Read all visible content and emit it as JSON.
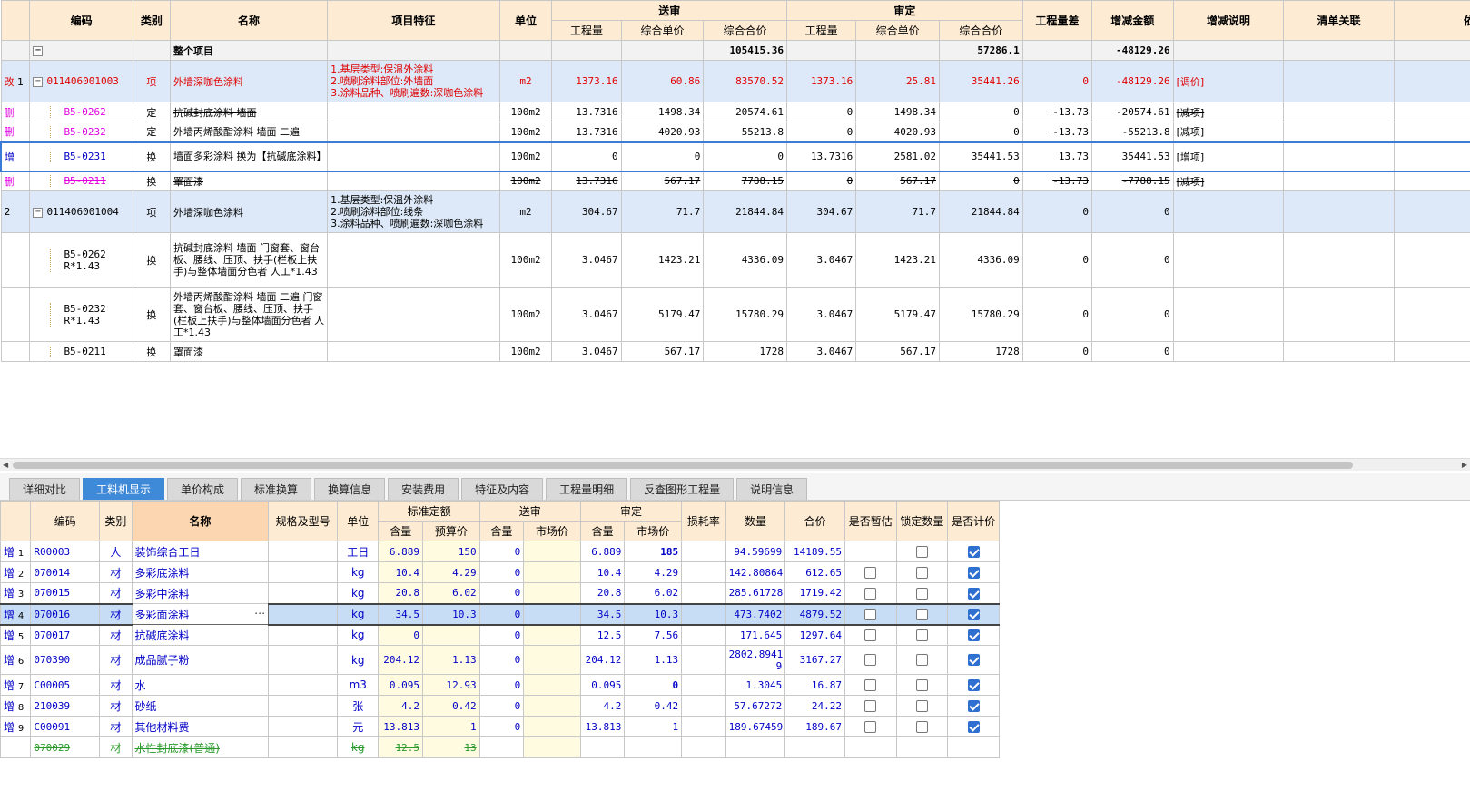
{
  "top": {
    "headers": {
      "code": "编码",
      "type": "类别",
      "name": "名称",
      "feature": "项目特征",
      "unit": "单位",
      "send": "送审",
      "audit": "审定",
      "qty": "工程量",
      "unit_price": "综合单价",
      "total": "综合合价",
      "qty_diff": "工程量差",
      "amt_change": "增减金额",
      "change_note": "增减说明",
      "list_link": "清单关联",
      "basis": "依据"
    },
    "summary": {
      "name": "整个项目",
      "send_total": "105415.36",
      "audit_total": "57286.1",
      "change": "-48129.26"
    },
    "rows": [
      {
        "flag": "改",
        "idx": "1",
        "code": "011406001003",
        "type": "项",
        "name": "外墙深咖色涂料",
        "feature": "1.基层类型:保温外涂料\n2.喷刷涂料部位:外墙面\n3.涂料品种、喷刷遍数:深咖色涂料",
        "unit": "m2",
        "s_qty": "1373.16",
        "s_price": "60.86",
        "s_total": "83570.52",
        "a_qty": "1373.16",
        "a_price": "25.81",
        "a_total": "35441.26",
        "diff": "0",
        "chg": "-48129.26",
        "note": "[调价]"
      },
      {
        "flag": "删",
        "code": "B5-0262",
        "type": "定",
        "name": "抗碱封底涂料 墙面",
        "unit": "100m2",
        "s_qty": "13.7316",
        "s_price": "1498.34",
        "s_total": "20574.61",
        "a_qty": "0",
        "a_price": "1498.34",
        "a_total": "0",
        "diff": "-13.73",
        "chg": "-20574.61",
        "note": "[减项]"
      },
      {
        "flag": "删",
        "code": "B5-0232",
        "type": "定",
        "name": "外墙丙烯酸酯涂料 墙面 二遍",
        "unit": "100m2",
        "s_qty": "13.7316",
        "s_price": "4020.93",
        "s_total": "55213.8",
        "a_qty": "0",
        "a_price": "4020.93",
        "a_total": "0",
        "diff": "-13.73",
        "chg": "-55213.8",
        "note": "[减项]"
      },
      {
        "flag": "增",
        "code": "B5-0231",
        "type": "换",
        "name": "墙面多彩涂料  换为【抗碱底涂料】",
        "unit": "100m2",
        "s_qty": "0",
        "s_price": "0",
        "s_total": "0",
        "a_qty": "13.7316",
        "a_price": "2581.02",
        "a_total": "35441.53",
        "diff": "13.73",
        "chg": "35441.53",
        "note": "[增项]"
      },
      {
        "flag": "删",
        "code": "B5-0211",
        "type": "换",
        "name": "罩面漆",
        "unit": "100m2",
        "s_qty": "13.7316",
        "s_price": "567.17",
        "s_total": "7788.15",
        "a_qty": "0",
        "a_price": "567.17",
        "a_total": "0",
        "diff": "-13.73",
        "chg": "-7788.15",
        "note": "[减项]"
      },
      {
        "idx": "2",
        "code": "011406001004",
        "type": "项",
        "name": "外墙深咖色涂料",
        "feature": "1.基层类型:保温外涂料\n2.喷刷涂料部位:线条\n3.涂料品种、喷刷遍数:深咖色涂料",
        "unit": "m2",
        "s_qty": "304.67",
        "s_price": "71.7",
        "s_total": "21844.84",
        "a_qty": "304.67",
        "a_price": "71.7",
        "a_total": "21844.84",
        "diff": "0",
        "chg": "0"
      },
      {
        "code": "B5-0262\nR*1.43",
        "type": "换",
        "name": "抗碱封底涂料 墙面  门窗套、窗台板、腰线、压顶、扶手(栏板上扶手)与整体墙面分色者 人工*1.43",
        "unit": "100m2",
        "s_qty": "3.0467",
        "s_price": "1423.21",
        "s_total": "4336.09",
        "a_qty": "3.0467",
        "a_price": "1423.21",
        "a_total": "4336.09",
        "diff": "0",
        "chg": "0"
      },
      {
        "code": "B5-0232\nR*1.43",
        "type": "换",
        "name": "外墙丙烯酸酯涂料 墙面 二遍 门窗套、窗台板、腰线、压顶、扶手(栏板上扶手)与整体墙面分色者 人工*1.43",
        "unit": "100m2",
        "s_qty": "3.0467",
        "s_price": "5179.47",
        "s_total": "15780.29",
        "a_qty": "3.0467",
        "a_price": "5179.47",
        "a_total": "15780.29",
        "diff": "0",
        "chg": "0"
      },
      {
        "code": "B5-0211",
        "type": "换",
        "name": "罩面漆",
        "unit": "100m2",
        "s_qty": "3.0467",
        "s_price": "567.17",
        "s_total": "1728",
        "a_qty": "3.0467",
        "a_price": "567.17",
        "a_total": "1728",
        "diff": "0",
        "chg": "0"
      }
    ]
  },
  "tabs": [
    "详细对比",
    "工料机显示",
    "单价构成",
    "标准换算",
    "换算信息",
    "安装费用",
    "特征及内容",
    "工程量明细",
    "反查图形工程量",
    "说明信息"
  ],
  "bottom": {
    "headers": {
      "code": "编码",
      "type": "类别",
      "name": "名称",
      "spec": "规格及型号",
      "unit": "单位",
      "std": "标准定额",
      "send": "送审",
      "audit": "审定",
      "content": "含量",
      "budget": "预算价",
      "market": "市场价",
      "loss": "损耗率",
      "qty": "数量",
      "total": "合价",
      "est": "是否暂估",
      "lock": "锁定数量",
      "price": "是否计价"
    },
    "rows": [
      {
        "flag": "增",
        "idx": "1",
        "code": "R00003",
        "type": "人",
        "name": "装饰综合工日",
        "unit": "工日",
        "std_c": "6.889",
        "std_b": "150",
        "s_c": "0",
        "s_m": "",
        "a_c": "6.889",
        "a_m": "185",
        "qty": "94.59699",
        "total": "14189.55",
        "est": null,
        "lock": false,
        "price": true
      },
      {
        "flag": "增",
        "idx": "2",
        "code": "070014",
        "type": "材",
        "name": "多彩底涂料",
        "unit": "kg",
        "std_c": "10.4",
        "std_b": "4.29",
        "s_c": "0",
        "s_m": "",
        "a_c": "10.4",
        "a_m": "4.29",
        "qty": "142.80864",
        "total": "612.65",
        "est": false,
        "lock": false,
        "price": true
      },
      {
        "flag": "增",
        "idx": "3",
        "code": "070015",
        "type": "材",
        "name": "多彩中涂料",
        "unit": "kg",
        "std_c": "20.8",
        "std_b": "6.02",
        "s_c": "0",
        "s_m": "",
        "a_c": "20.8",
        "a_m": "6.02",
        "qty": "285.61728",
        "total": "1719.42",
        "est": false,
        "lock": false,
        "price": true
      },
      {
        "flag": "增",
        "idx": "4",
        "code": "070016",
        "type": "材",
        "name": "多彩面涂料",
        "unit": "kg",
        "std_c": "34.5",
        "std_b": "10.3",
        "s_c": "0",
        "s_m": "",
        "a_c": "34.5",
        "a_m": "10.3",
        "qty": "473.7402",
        "total": "4879.52",
        "est": false,
        "lock": false,
        "price": true
      },
      {
        "flag": "增",
        "idx": "5",
        "code": "070017",
        "type": "材",
        "name": "抗碱底涂料",
        "unit": "kg",
        "std_c": "0",
        "std_b": "",
        "s_c": "0",
        "s_m": "",
        "a_c": "12.5",
        "a_m": "7.56",
        "qty": "171.645",
        "total": "1297.64",
        "est": false,
        "lock": false,
        "price": true
      },
      {
        "flag": "增",
        "idx": "6",
        "code": "070390",
        "type": "材",
        "name": "成品腻子粉",
        "unit": "kg",
        "std_c": "204.12",
        "std_b": "1.13",
        "s_c": "0",
        "s_m": "",
        "a_c": "204.12",
        "a_m": "1.13",
        "qty": "2802.8941\n9",
        "total": "3167.27",
        "est": false,
        "lock": false,
        "price": true
      },
      {
        "flag": "增",
        "idx": "7",
        "code": "C00005",
        "type": "材",
        "name": "水",
        "unit": "m3",
        "std_c": "0.095",
        "std_b": "12.93",
        "s_c": "0",
        "s_m": "",
        "a_c": "0.095",
        "a_m": "0",
        "qty": "1.3045",
        "total": "16.87",
        "est": false,
        "lock": false,
        "price": true
      },
      {
        "flag": "增",
        "idx": "8",
        "code": "210039",
        "type": "材",
        "name": "砂纸",
        "unit": "张",
        "std_c": "4.2",
        "std_b": "0.42",
        "s_c": "0",
        "s_m": "",
        "a_c": "4.2",
        "a_m": "0.42",
        "qty": "57.67272",
        "total": "24.22",
        "est": false,
        "lock": false,
        "price": true
      },
      {
        "flag": "增",
        "idx": "9",
        "code": "C00091",
        "type": "材",
        "name": "其他材料费",
        "unit": "元",
        "std_c": "13.813",
        "std_b": "1",
        "s_c": "0",
        "s_m": "",
        "a_c": "13.813",
        "a_m": "1",
        "qty": "189.67459",
        "total": "189.67",
        "est": false,
        "lock": false,
        "price": true
      },
      {
        "flag": "",
        "idx": "",
        "code": "070029",
        "type": "材",
        "name": "水性封底漆(普通)",
        "unit": "kg",
        "std_c": "12.5",
        "std_b": "13",
        "s_c": "",
        "s_m": "",
        "a_c": "",
        "a_m": "",
        "qty": "",
        "total": "",
        "est": null,
        "lock": null,
        "price": null
      }
    ]
  }
}
